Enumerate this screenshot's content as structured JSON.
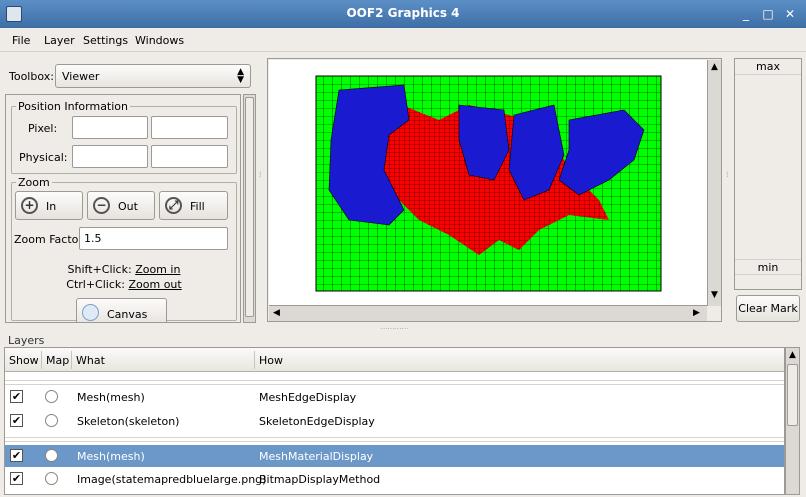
{
  "window": {
    "title": "OOF2 Graphics 4",
    "controls": [
      "_",
      "□",
      "✕"
    ]
  },
  "menu": [
    "File",
    "Layer",
    "Settings",
    "Windows"
  ],
  "toolbox": {
    "label": "Toolbox:",
    "selected": "Viewer",
    "position": {
      "legend": "Position Information",
      "pixel_label": "Pixel:",
      "physical_label": "Physical:",
      "pixel_x": "",
      "pixel_y": "",
      "physical_x": "",
      "physical_y": ""
    },
    "zoom": {
      "legend": "Zoom",
      "in_label": "In",
      "out_label": "Out",
      "fill_label": "Fill",
      "factor_label": "Zoom Factor:",
      "factor_value": "1.5",
      "hint1_prefix": "Shift+Click:",
      "hint1_link": "Zoom in",
      "hint2_prefix": "Ctrl+Click:",
      "hint2_link": "Zoom out"
    },
    "canvas_info_label": "Canvas Info"
  },
  "colormap": {
    "max_label": "max",
    "min_label": "min",
    "clear_label": "Clear Mark"
  },
  "layers": {
    "title": "Layers",
    "columns": [
      "Show",
      "Map",
      "What",
      "How"
    ],
    "rows": [
      {
        "show": true,
        "what": "Mesh(mesh)",
        "how": "MeshEdgeDisplay",
        "selected": false
      },
      {
        "show": true,
        "what": "Skeleton(skeleton)",
        "how": "SkeletonEdgeDisplay",
        "selected": false
      },
      {
        "show": true,
        "what": "Mesh(mesh)",
        "how": "MeshMaterialDisplay",
        "selected": true
      },
      {
        "show": true,
        "what": "Image(statemapredbluelarge.png)",
        "how": "BitmapDisplayMethod",
        "selected": false
      }
    ]
  },
  "colors": {
    "green": "#00ff00",
    "red": "#ff0000",
    "blue": "#0000cc",
    "selection": "#6c98c9"
  }
}
